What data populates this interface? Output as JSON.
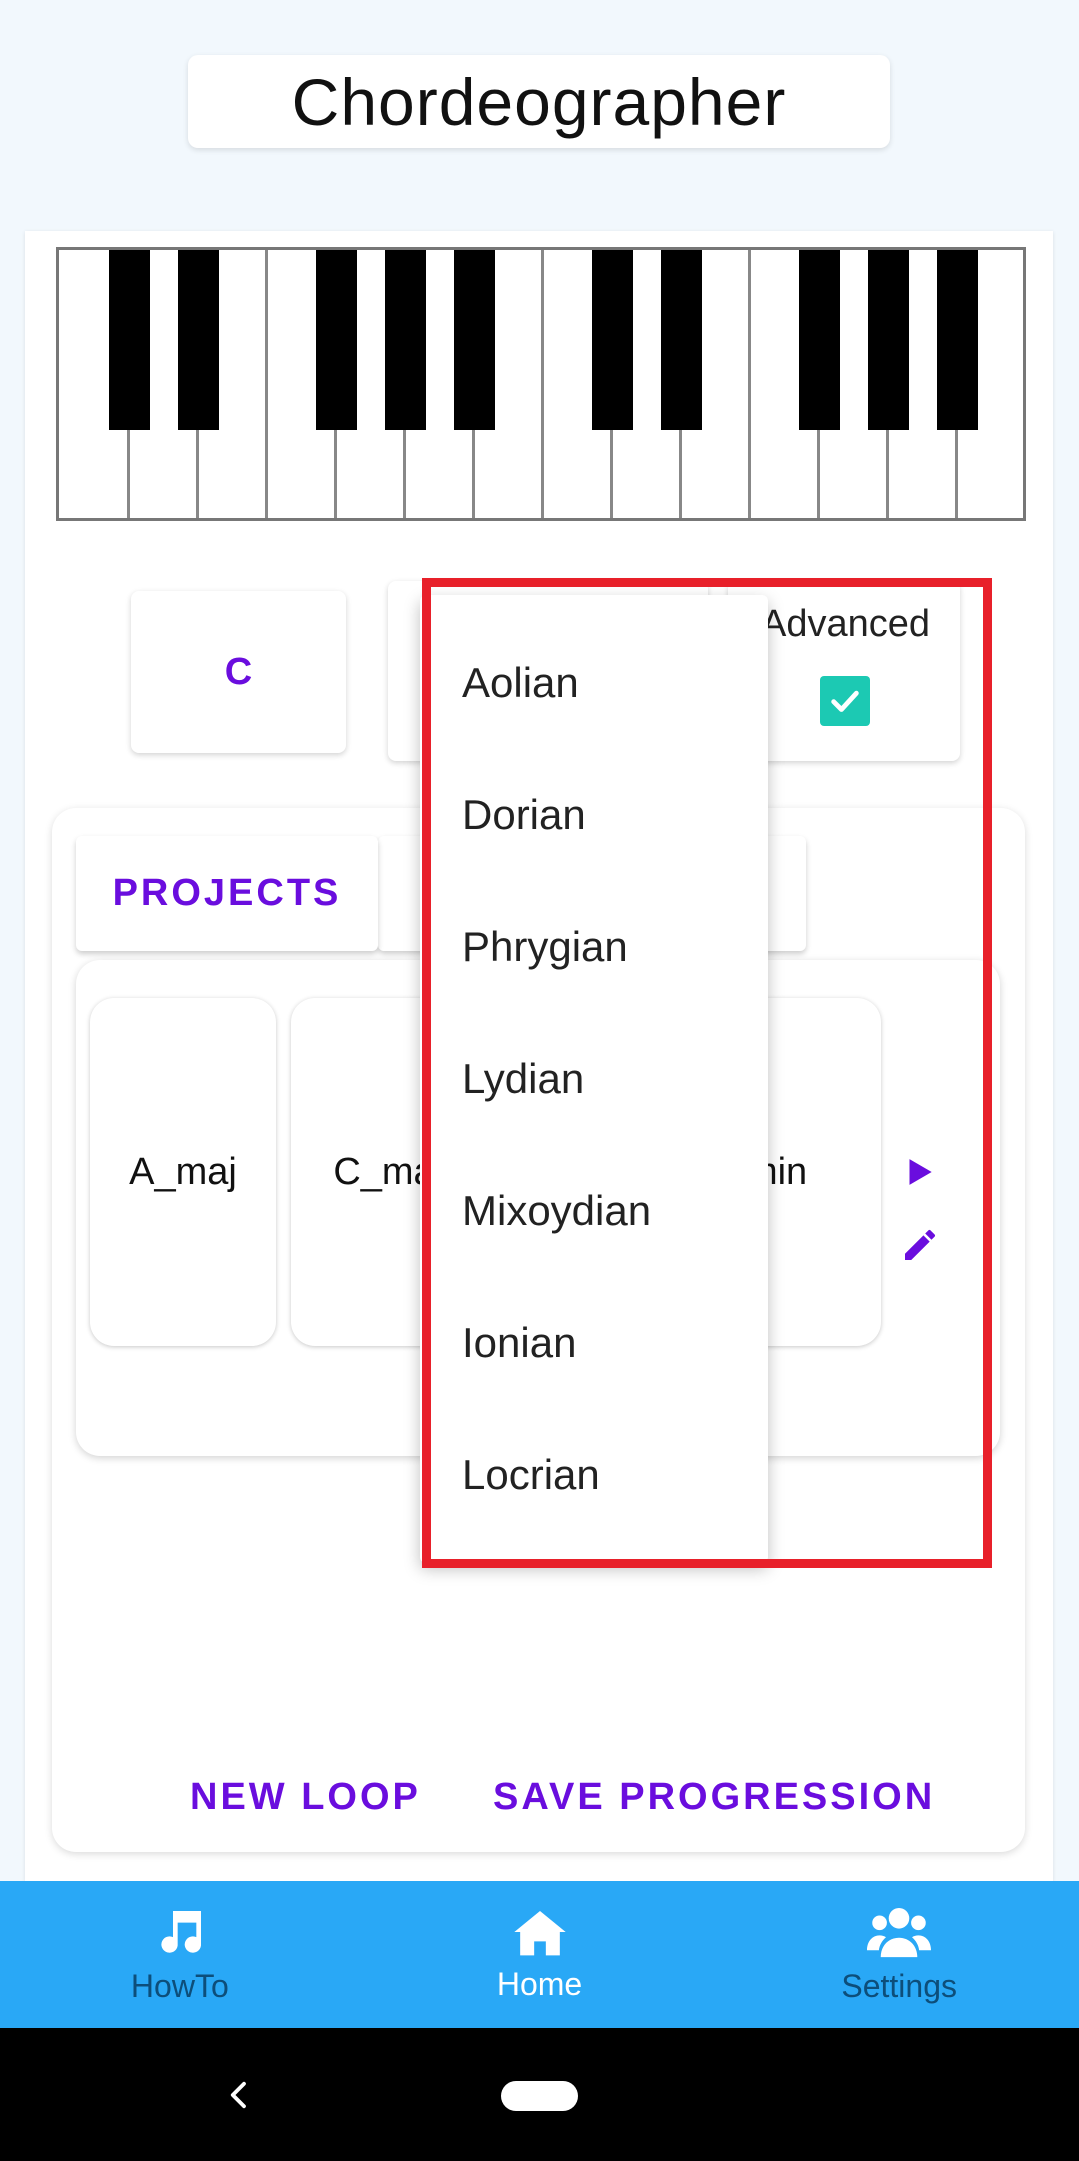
{
  "app": {
    "title": "Chordeographer"
  },
  "selectors": {
    "key": "C",
    "advanced_label": "Advanced",
    "advanced_checked": true
  },
  "tabs": {
    "projects": "PROJECTS"
  },
  "loop": {
    "chords": [
      "A_maj",
      "C_ma",
      "_min"
    ]
  },
  "actions": {
    "new_loop": "NEW LOOP",
    "save_progression": "SAVE PROGRESSION"
  },
  "mode_dropdown": {
    "options": [
      "Aolian",
      "Dorian",
      "Phrygian",
      "Lydian",
      "Mixoydian",
      "Ionian",
      "Locrian"
    ]
  },
  "nav": {
    "items": [
      {
        "label": "HowTo",
        "icon": "music-note-icon"
      },
      {
        "label": "Home",
        "icon": "home-icon"
      },
      {
        "label": "Settings",
        "icon": "users-icon"
      }
    ]
  },
  "colors": {
    "accent": "#6a0dde",
    "nav_bg": "#29a8f6",
    "highlight": "#e8202a",
    "checkbox": "#1cc9b3"
  }
}
